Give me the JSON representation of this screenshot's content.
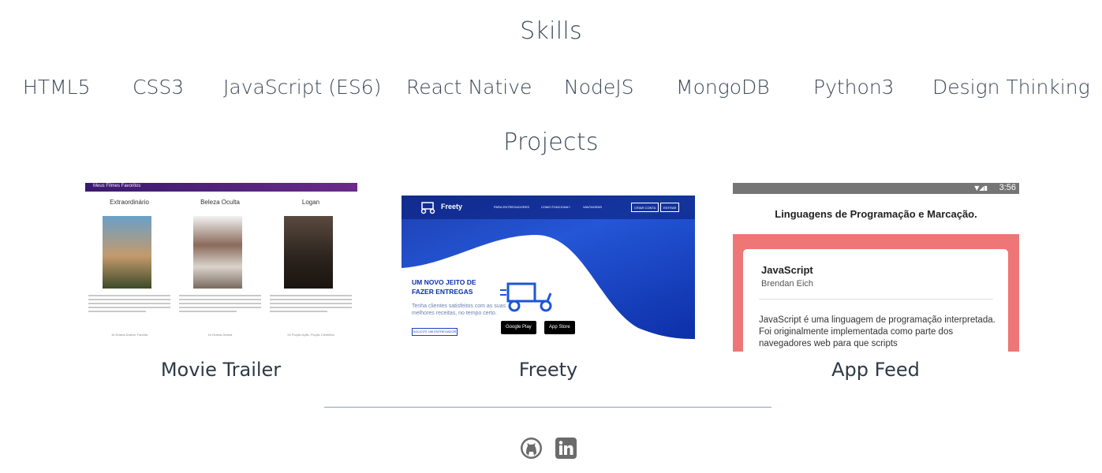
{
  "skills": {
    "title": "Skills",
    "items": [
      "HTML5",
      "CSS3",
      "JavaScript (ES6)",
      "React Native",
      "NodeJS",
      "MongoDB",
      "Python3",
      "Design Thinking"
    ]
  },
  "projects": {
    "title": "Projects",
    "items": [
      {
        "label": "Movie Trailer",
        "thumb": {
          "bar_title": "Meus Filmes Favoritos",
          "movies": [
            {
              "title": "Extraordinário",
              "tag": "1h Drama Drama, Família"
            },
            {
              "title": "Beleza Oculta",
              "tag": "1h Drama Drama"
            },
            {
              "title": "Logan",
              "tag": "2h Ficção Ação, Ficção Científica"
            }
          ]
        }
      },
      {
        "label": "Freety",
        "thumb": {
          "brand": "Freety",
          "nav": [
            "PARA ENTREGADORES",
            "COMO FUNCIONA?",
            "VANTAGENS"
          ],
          "buttons": [
            "CRIAR CONTA",
            "ENTRAR"
          ],
          "headline_1": "UM NOVO JEITO DE",
          "headline_2": "FAZER ENTREGAS",
          "subtitle": "Tenha clientes satisfeitos com as suas melhores receitas, no tempo certo.",
          "cta": "SOLICITE UM ENTREGADOR",
          "store_1": "Google Play",
          "store_2": "App Store"
        }
      },
      {
        "label": "App Feed",
        "thumb": {
          "time": "3:56",
          "title": "Linguagens de Programação e Marcação.",
          "card_title": "JavaScript",
          "card_author": "Brendan Eich",
          "card_body": "JavaScript é uma linguagem de programação interpretada. Foi originalmente implementada como parte dos navegadores web para que scripts"
        }
      }
    ]
  },
  "social": {
    "icons": [
      "github-icon",
      "linkedin-icon"
    ]
  },
  "colors": {
    "text": "#3d4a58",
    "divider": "#8ba0ad",
    "app_accent": "#ee7676",
    "freety_blue": "#2456d6"
  }
}
